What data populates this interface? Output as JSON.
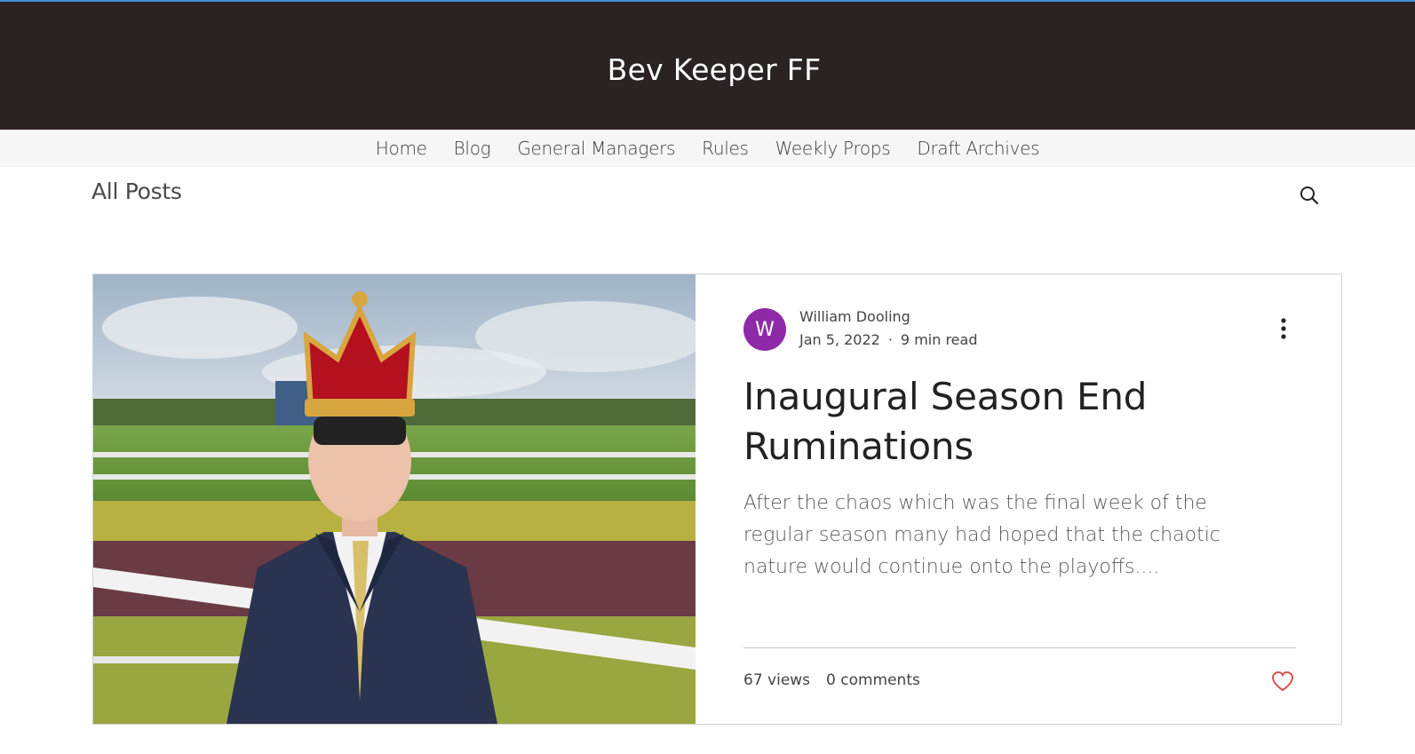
{
  "header": {
    "site_title": "Bev Keeper FF"
  },
  "nav": {
    "items": [
      {
        "label": "Home"
      },
      {
        "label": "Blog"
      },
      {
        "label": "General Managers"
      },
      {
        "label": "Rules"
      },
      {
        "label": "Weekly Props"
      },
      {
        "label": "Draft Archives"
      }
    ]
  },
  "blog": {
    "category_label": "All Posts",
    "search_icon": "search-icon"
  },
  "post": {
    "author_initial": "W",
    "author_name": "William Dooling",
    "date": "Jan 5, 2022",
    "dot": "·",
    "read_time": "9 min read",
    "title": "Inaugural Season End Ruminations",
    "excerpt": "After the chaos which was the final week of the regular season many had hoped that the chaotic nature would continue onto the playoffs....",
    "views": "67 views",
    "comments": "0 comments",
    "more_icon": "more-vertical-icon",
    "like_icon": "heart-icon"
  },
  "colors": {
    "header_bg": "#2a2322",
    "nav_bg": "#f6f6f6",
    "avatar_bg": "#8e2aa8",
    "like_color": "#d9534f",
    "accent_line": "#3d8fd6"
  }
}
